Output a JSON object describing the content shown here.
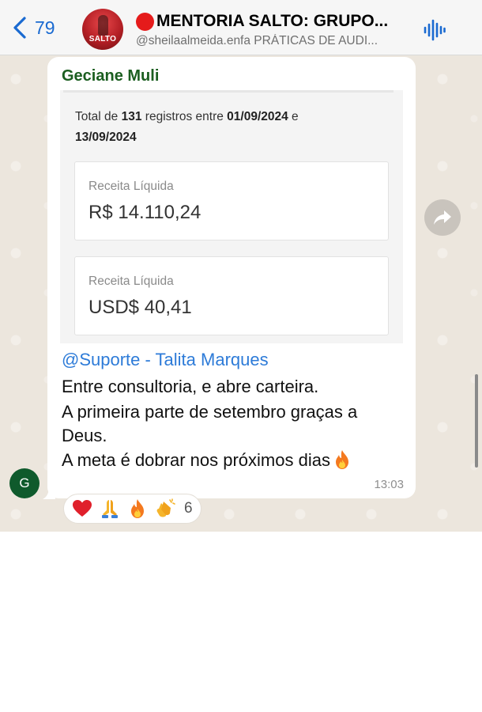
{
  "header": {
    "back_count": "79",
    "title": "MENTORIA SALTO: GRUPO...",
    "subtitle": "@sheilaalmeida.enfa PRÁTICAS DE AUDI...",
    "avatar_text": "SALTO"
  },
  "message": {
    "sender": "Geciane Muli",
    "summary": {
      "prefix": "Total de ",
      "count": "131",
      "middle": " registros entre ",
      "date_start": "01/09/2024",
      "conj": " e",
      "date_end": "13/09/2024"
    },
    "metrics": [
      {
        "label": "Receita Líquida",
        "value": "R$ 14.110,24"
      },
      {
        "label": "Receita Líquida",
        "value": "USD$ 40,41"
      }
    ],
    "mention": "@Suporte - Talita Marques",
    "lines": [
      "Entre consultoria, e abre carteira.",
      "A primeira parte de setembro graças a",
      "Deus.",
      "A meta é dobrar nos próximos dias"
    ],
    "time": "13:03"
  },
  "sender_avatar": "G",
  "reactions": {
    "emojis": [
      "heart-icon",
      "praying-hands-icon",
      "fire-icon",
      "clapping-hands-icon"
    ],
    "count": "6"
  },
  "colors": {
    "accent": "#1a6ad1",
    "sender": "#1b5e20",
    "mention": "#2d7bd8",
    "chat_bg": "#ece6dd"
  }
}
